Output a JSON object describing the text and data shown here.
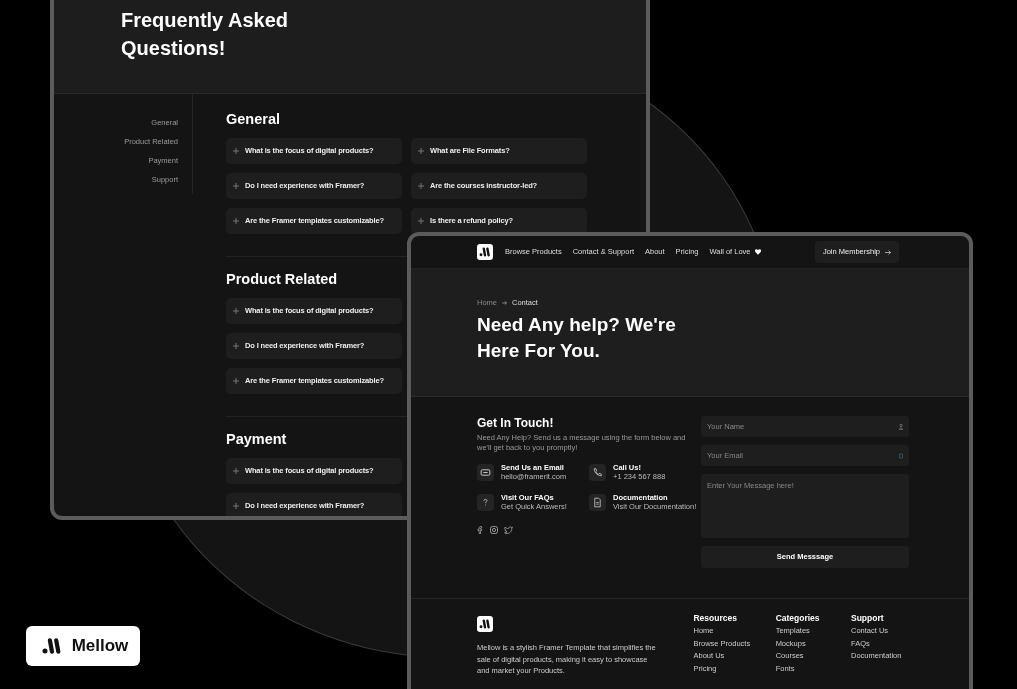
{
  "faq_page": {
    "title": "Frequently Asked Questions!",
    "sidebar": [
      {
        "label": "General"
      },
      {
        "label": "Product Related"
      },
      {
        "label": "Payment"
      },
      {
        "label": "Support"
      }
    ],
    "sections": [
      {
        "heading": "General",
        "columns": [
          [
            "What is the focus of digital products?",
            "Do I need experience with Framer?",
            "Are the Framer templates customizable?"
          ],
          [
            "What are File Formats?",
            "Are the courses instructor-led?",
            "Is there a refund policy?"
          ]
        ]
      },
      {
        "heading": "Product Related",
        "columns": [
          [
            "What is the focus of digital products?",
            "Do I need experience with Framer?",
            "Are the Framer templates customizable?"
          ]
        ]
      },
      {
        "heading": "Payment",
        "columns": [
          [
            "What is the focus of digital products?",
            "Do I need experience with Framer?"
          ]
        ]
      }
    ]
  },
  "contact_page": {
    "nav": {
      "links": [
        {
          "label": "Browse Products",
          "kind": "text"
        },
        {
          "label": "Contact & Support",
          "kind": "text"
        },
        {
          "label": "About",
          "kind": "text"
        },
        {
          "label": "Pricing",
          "kind": "text"
        },
        {
          "label": "Wall of Love",
          "kind": "heart"
        }
      ],
      "button": "Join Membership"
    },
    "breadcrumb": [
      "Home",
      "Contact"
    ],
    "title": "Need Any help? We're Here For You.",
    "get_in_touch": {
      "heading": "Get In Touch!",
      "text": "Need Any Help? Send us a message using the form below and we'll get back to you promptly!"
    },
    "contacts": [
      {
        "kind": "email",
        "title": "Send Us an Email",
        "detail": "hello@framerit.com"
      },
      {
        "kind": "phone",
        "title": "Call Us!",
        "detail": "+1 234 567 888"
      },
      {
        "kind": "faq",
        "title": "Visit Our FAQs",
        "detail": "Get Quick Answers!"
      },
      {
        "kind": "doc",
        "title": "Documentation",
        "detail": "Visit Our Documentation!"
      }
    ],
    "form": {
      "name_placeholder": "Your Name",
      "email_placeholder": "Your Email",
      "message_placeholder": "Enter Your Message here!",
      "submit": "Send Messsage"
    },
    "footer": {
      "text": "Mellow is a stylish Framer Template that simplifies the sale of digital products, making it easy to showcase and market your Products.",
      "columns": [
        {
          "heading": "Resources",
          "links": [
            "Home",
            "Browse Products",
            "About Us",
            "Pricing"
          ]
        },
        {
          "heading": "Categories",
          "links": [
            "Templates",
            "Mockups",
            "Courses",
            "Fonts"
          ]
        },
        {
          "heading": "Support",
          "links": [
            "Contact Us",
            "FAQs",
            "Documentation"
          ]
        }
      ]
    }
  },
  "brand_badge": {
    "name": "Mellow"
  }
}
